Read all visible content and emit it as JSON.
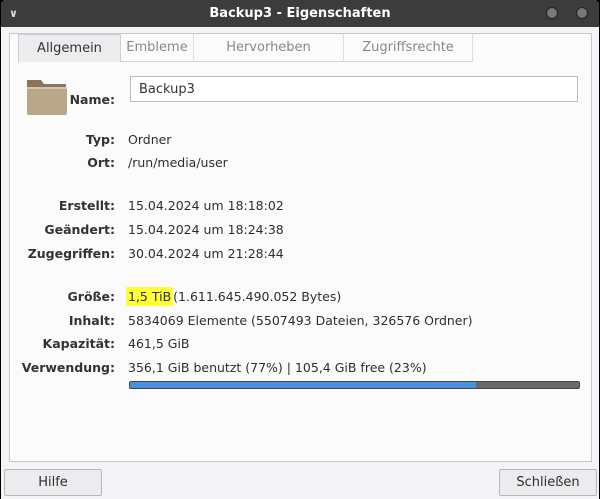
{
  "window": {
    "title": "Backup3 - Eigenschaften"
  },
  "tabs": [
    {
      "label": "Allgemein",
      "active": true
    },
    {
      "label": "Embleme"
    },
    {
      "label": "Hervorheben"
    },
    {
      "label": "Zugriffsrechte"
    }
  ],
  "general": {
    "name_label": "Name:",
    "name_value": "Backup3",
    "rows": [
      {
        "label": "Typ:",
        "value": "Ordner"
      },
      {
        "label": "Ort:",
        "value": "/run/media/user"
      },
      {
        "label": "Erstellt:",
        "value": "15.04.2024 um 18:18:02"
      },
      {
        "label": "Geändert:",
        "value": "15.04.2024 um 18:24:38"
      },
      {
        "label": "Zugegriffen:",
        "value": "30.04.2024 um 21:28:44"
      },
      {
        "label": "Größe:",
        "value_highlight": "1,5 TiB",
        "value": "(1.611.645.490.052 Bytes)"
      },
      {
        "label": "Inhalt:",
        "value": "5834069 Elemente (5507493 Dateien, 326576 Ordner)"
      },
      {
        "label": "Kapazität:",
        "value": "461,5 GiB"
      },
      {
        "label": "Verwendung:",
        "value": "356,1 GiB benutzt (77%) | 105,4 GiB free (23%)"
      }
    ],
    "usage_percent": 77,
    "usage_color": "#4a90e2"
  },
  "buttons": {
    "help": "Hilfe",
    "close": "Schließen"
  }
}
